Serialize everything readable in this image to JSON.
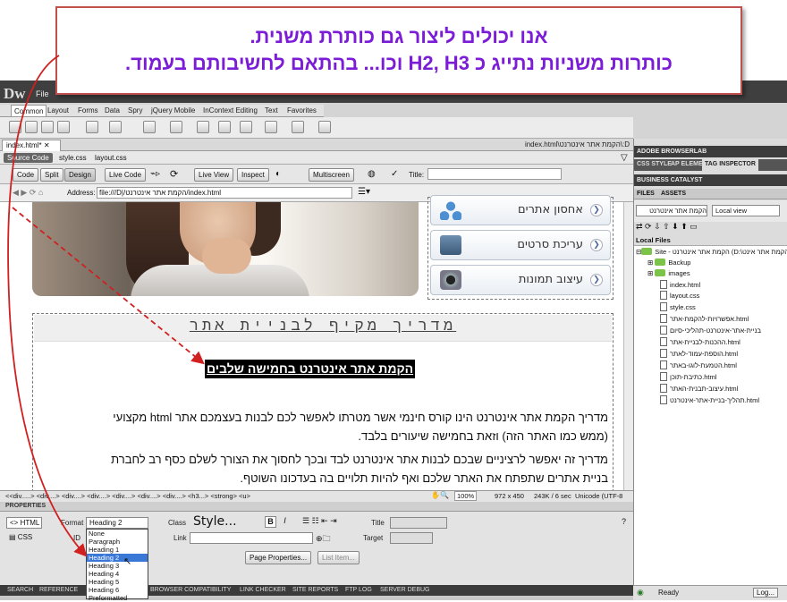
{
  "callout": {
    "line1": "אנו יכולים ליצור גם כותרת משנית.",
    "line2": "כותרות משניות נתייג כ H2, H3 וכו... בהתאם לחשיבותם בעמוד."
  },
  "app": {
    "logo": "Dw",
    "menu": [
      "File"
    ]
  },
  "insert_tabs": [
    "Common",
    "Layout",
    "Forms",
    "Data",
    "Spry",
    "jQuery Mobile",
    "InContext Editing",
    "Text",
    "Favorites"
  ],
  "document": {
    "tab": "index.html*",
    "path": "D:\\הקמת אתר אינטרנט\\index.html",
    "source_code": "Source Code",
    "related": [
      "style.css",
      "layout.css"
    ],
    "views": {
      "code": "Code",
      "split": "Split",
      "design": "Design",
      "live_code": "Live Code",
      "live_view": "Live View",
      "inspect": "Inspect",
      "multiscreen": "Multiscreen",
      "title_label": "Title:"
    },
    "address_label": "Address:",
    "address": "file:///D|/הקמת אתר אינטרנט/index.html"
  },
  "page": {
    "menu_items": [
      "אחסון אתרים",
      "עריכת סרטים",
      "עיצוב תמונות"
    ],
    "heading1": "מדריך מקיף לבניית אתר",
    "heading2": "הקמת אתר אינטרנט בחמישה שלבים",
    "para1": "מדריך הקמת אתר אינטרנט הינו קורס חינמי אשר מטרתו לאפשר לכם לבנות בעצמכם אתר html מקצועי (ממש כמו האתר הזה) וזאת בחמישה שיעורים בלבד.",
    "para2": "מדריך זה יאפשר לרציניים שבכם לבנות אתר אינטרנט לבד ובכך לחסוך את הצורך לשלם כסף רב לחברת בניית אתרים שתפתח את האתר שלכם ואף להיות תלויים בה בעדכונו השוטף."
  },
  "tag_selector": {
    "tags": "<<div.....> <div....> <div....> <div....> <div....> <div....> <div....> <h3...> <strong> <u>",
    "zoom": "100%",
    "size": "972 x 450",
    "weight": "243K / 6 sec",
    "encoding": "Unicode (UTF-8"
  },
  "properties": {
    "title": "PROPERTIES",
    "html": "HTML",
    "css": "CSS",
    "format_label": "Format",
    "format_value": "Heading 2",
    "id_label": "ID",
    "class_label": "Class",
    "class_value": "Style...",
    "link_label": "Link",
    "title_label": "Title",
    "target_label": "Target",
    "page_properties": "Page Properties...",
    "list_item": "List Item...",
    "bold": "B",
    "italic": "I",
    "format_options": [
      "None",
      "Paragraph",
      "Heading 1",
      "Heading 2",
      "Heading 3",
      "Heading 4",
      "Heading 5",
      "Heading 6",
      "Preformatted"
    ],
    "selected_option": "Heading 2"
  },
  "bottom_panels": [
    "SEARCH",
    "REFERENCE",
    "BROWSER COMPATIBILITY",
    "LINK CHECKER",
    "SITE REPORTS",
    "FTP LOG",
    "SERVER DEBUG"
  ],
  "right_panel": {
    "browserlab": "ADOBE BROWSERLAB",
    "css_tabs": [
      "CSS STYLE",
      "AP ELEME",
      "TAG INSPECTOR"
    ],
    "business": "BUSINESS CATALYST",
    "file_tabs": [
      "FILES",
      "ASSETS"
    ],
    "site_select": "הקמת אתר אינטרנט",
    "view_select": "Local view",
    "local_files": "Local Files",
    "site_root": "Site - הקמת אתר אינטרנט (D:\\הקמת אתר אינט...",
    "files": [
      "Backup",
      "images",
      "index.html",
      "layout.css",
      "style.css",
      "אפשרויות-להקמת-אתר.html",
      "בניית-אתר-אינטרנט-תהליכי-סיום",
      "ההכנות-לבניית-אתר.html",
      "הוספת-עמוד-לאתר.html",
      "הטמעת-לוגו-באתר.html",
      "כתיבת-תוכן.html",
      "עיצוב-תבנית-האתר.html",
      "תהליך-בניית-אתר-אינטרנט.html"
    ],
    "status": "Ready",
    "log": "Log..."
  }
}
